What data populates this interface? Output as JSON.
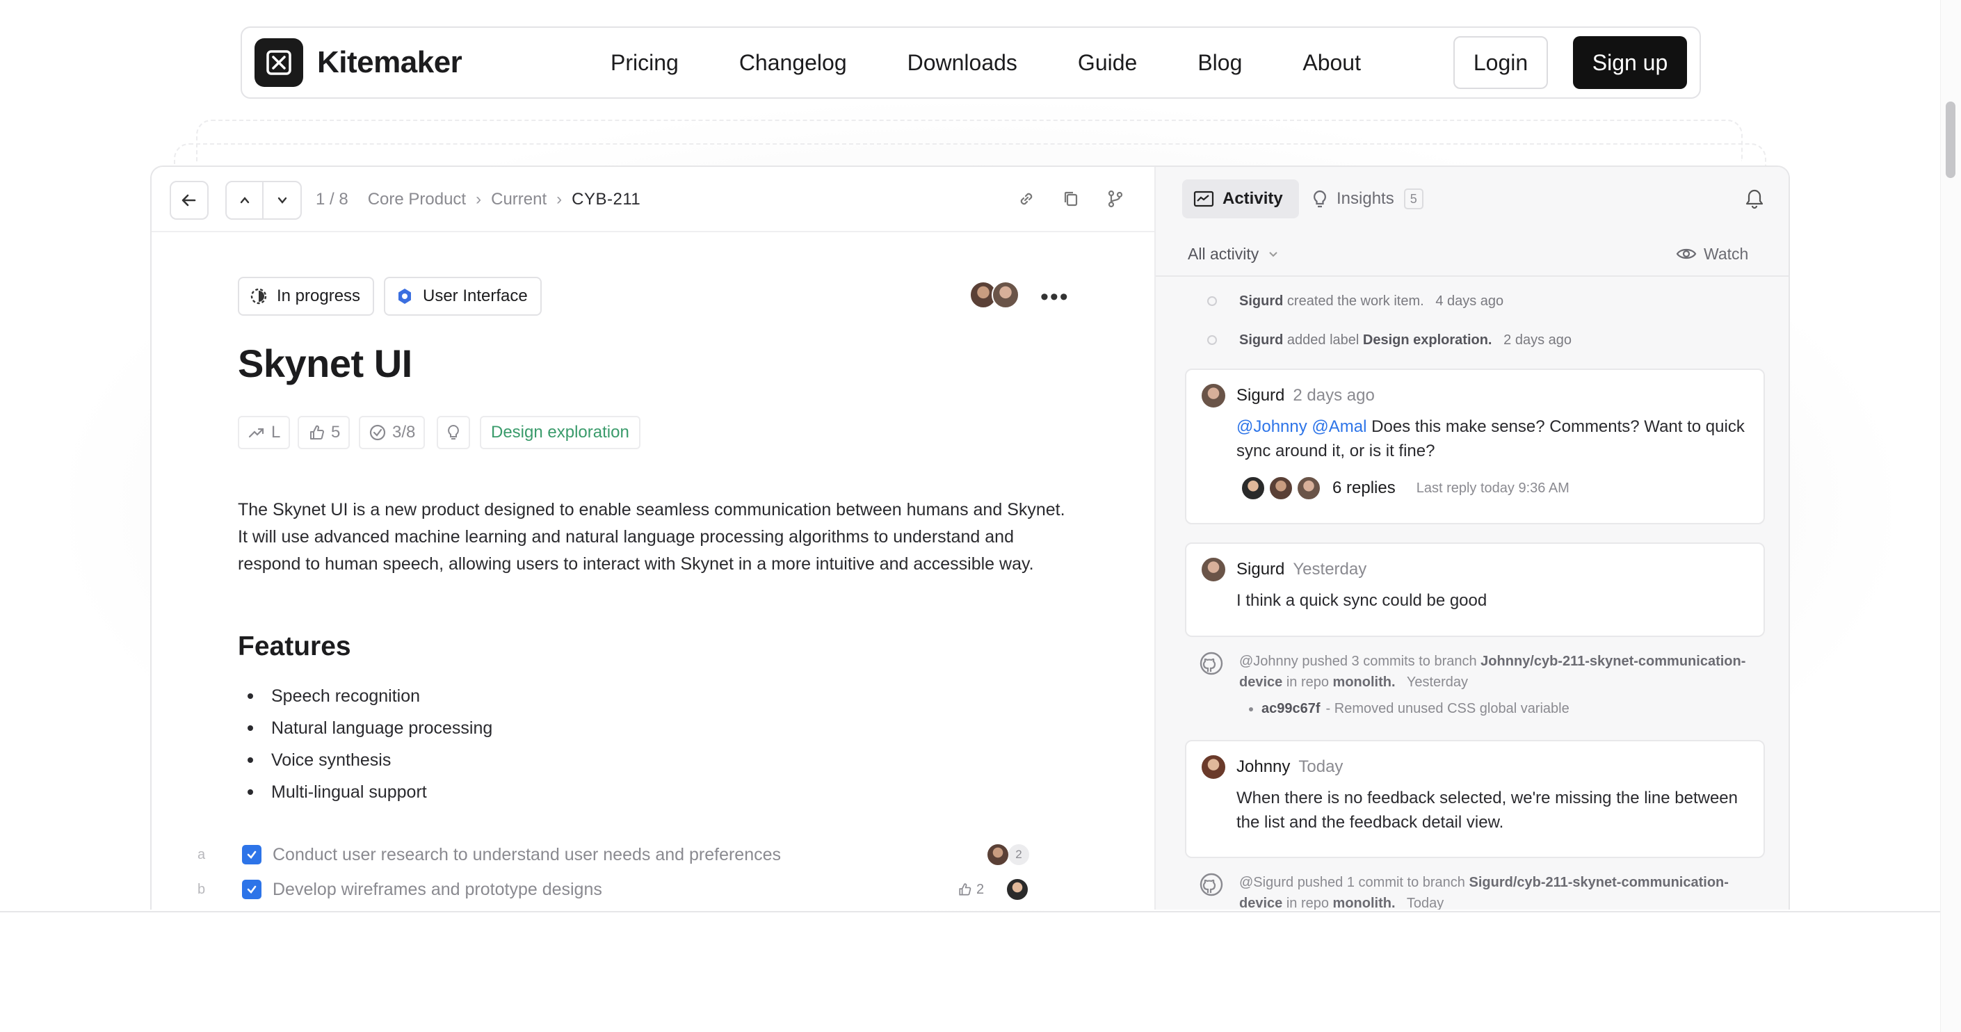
{
  "nav": {
    "brand": "Kitemaker",
    "links": [
      "Pricing",
      "Changelog",
      "Downloads",
      "Guide",
      "Blog",
      "About"
    ],
    "login_label": "Login",
    "signup_label": "Sign up"
  },
  "toolbar": {
    "position": "1 / 8",
    "breadcrumb": [
      "Core Product",
      "Current",
      "CYB-211"
    ]
  },
  "item": {
    "status": "In progress",
    "label_chip": "User Interface",
    "title": "Skynet UI",
    "props": {
      "effort": "L",
      "watchers": "5",
      "checklist": "3/8",
      "label": "Design exploration"
    },
    "description": "The Skynet UI is a new product designed to enable seamless communication between humans and Skynet. It will use advanced machine learning and natural language processing algorithms to understand and respond to human speech, allowing users to interact with Skynet in a more intuitive and accessible way.",
    "features_heading": "Features",
    "features": [
      "Speech recognition",
      "Natural language processing",
      "Voice synthesis",
      "Multi-lingual support"
    ],
    "todos": [
      {
        "letter": "a",
        "text": "Conduct user research to understand user needs and preferences",
        "count": "2"
      },
      {
        "letter": "b",
        "text": "Develop wireframes and prototype designs",
        "count": "2"
      }
    ]
  },
  "activity": {
    "tab_activity": "Activity",
    "tab_insights": "Insights",
    "insights_count": "5",
    "filter": "All activity",
    "watch": "Watch",
    "events": [
      {
        "who": "Sigurd",
        "text": "created the work item.",
        "time": "4 days ago"
      },
      {
        "who": "Sigurd",
        "text": "added label",
        "label": "Design exploration.",
        "time": "2 days ago"
      }
    ],
    "comments": [
      {
        "who": "Sigurd",
        "time": "2 days ago",
        "mentions": "@Johnny @Amal",
        "text": "Does this make sense? Comments? Want to quick sync around it, or is it fine?",
        "replies": "6 replies",
        "last_reply": "Last reply today 9:36 AM"
      },
      {
        "who": "Sigurd",
        "time": "Yesterday",
        "text": "I think a quick sync could be good"
      },
      {
        "who": "Johnny",
        "time": "Today",
        "text": "When there is no feedback selected, we're missing the line between the list and the feedback detail view."
      }
    ],
    "commits": [
      {
        "actor": "@Johnny",
        "text1": "pushed 3 commits to branch",
        "branch": "Johnny/cyb-211-skynet-communication-device",
        "text2": "in repo",
        "repo": "monolith.",
        "time": "Yesterday",
        "commit_hash": "ac99c67f",
        "commit_msg": "- Removed unused CSS global variable"
      },
      {
        "actor": "@Sigurd",
        "text1": "pushed 1 commit to branch",
        "branch": "Sigurd/cyb-211-skynet-communication-device",
        "text2": "in repo",
        "repo": "monolith.",
        "time": "Today"
      }
    ]
  },
  "colors": {
    "accent": "#2d74e8",
    "label_green": "#3a9b6b",
    "dark": "#111111"
  }
}
